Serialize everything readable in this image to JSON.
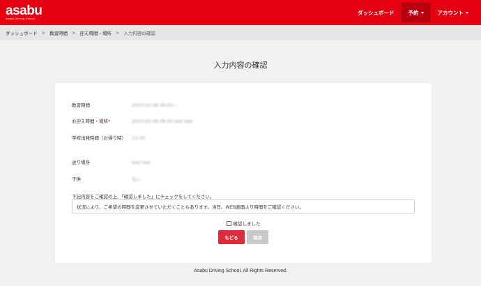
{
  "brand": {
    "logo_main": "asabu",
    "logo_sub": "Asabu Driving School"
  },
  "nav": {
    "dashboard": "ダッシュボード",
    "reservation": "予約",
    "account": "アカウント"
  },
  "breadcrumb": {
    "items": [
      "ダッシュボード",
      "教習時間",
      "迎え時間・場所"
    ],
    "current": "入力内容の確認"
  },
  "page_title": "入力内容の確認",
  "form": {
    "lesson_time": {
      "label": "教習時間",
      "value": "2023-02-08 09:00~"
    },
    "pickup": {
      "label": "お迎え時間・場所",
      "required_mark": "*",
      "value": "2023-02-08 08:35 test test"
    },
    "departure": {
      "label": "学校出発時間（お帰り時）",
      "value": "13:30"
    },
    "dropoff": {
      "label": "送り場所",
      "value": "test test"
    },
    "child": {
      "label": "子供",
      "value": "なし"
    }
  },
  "notice_label": "下記内容をご確認の上、「確認しました」にチェックをしてください。",
  "notice_text": "状況により、ご希望の時間を変更させていただくこともあります。当日、WEB画面より時間をご確認ください。",
  "confirm_label": "確認しました",
  "buttons": {
    "back": "もどる",
    "save": "保存"
  },
  "footer": "Asabu Driving School, All Rights Reserved.",
  "colors": {
    "brand_red": "#e50012",
    "back_button": "#e02b3c",
    "save_disabled": "#c9c9c9"
  }
}
